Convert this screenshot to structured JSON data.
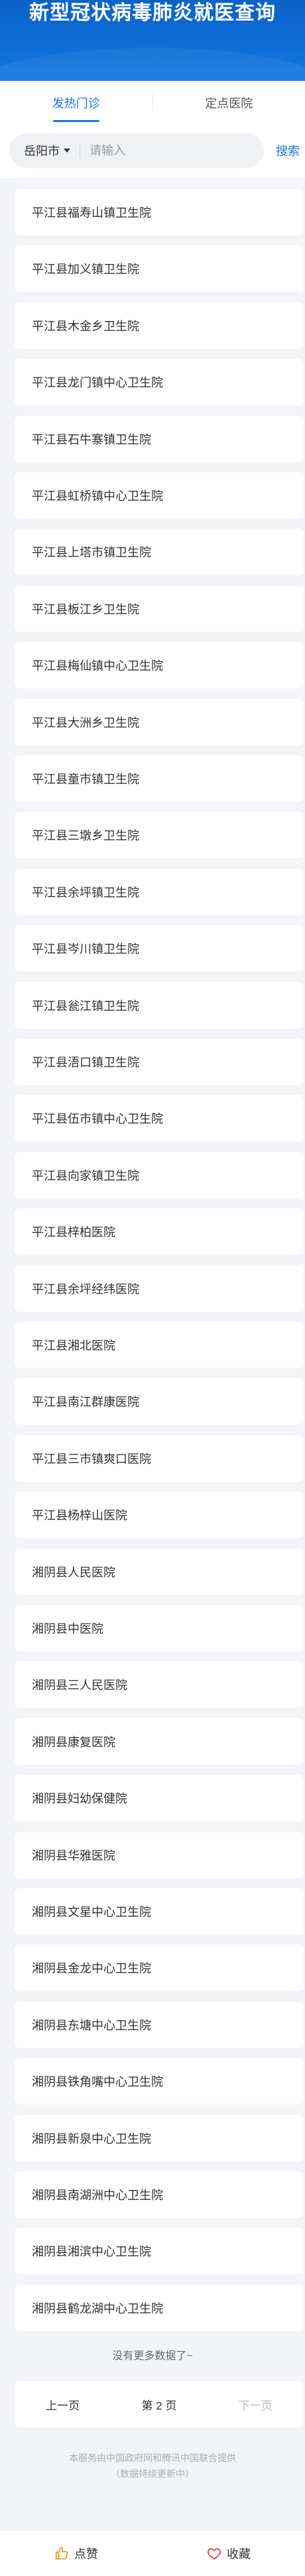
{
  "header": {
    "title": "新型冠状病毒肺炎就医查询"
  },
  "tabs": [
    {
      "label": "发热门诊",
      "active": true
    },
    {
      "label": "定点医院",
      "active": false
    }
  ],
  "search": {
    "city": "岳阳市",
    "placeholder": "请输入",
    "button": "搜索"
  },
  "hospitals": [
    "平江县福寿山镇卫生院",
    "平江县加义镇卫生院",
    "平江县木金乡卫生院",
    "平江县龙门镇中心卫生院",
    "平江县石牛寨镇卫生院",
    "平江县虹桥镇中心卫生院",
    "平江县上塔市镇卫生院",
    "平江县板江乡卫生院",
    "平江县梅仙镇中心卫生院",
    "平江县大洲乡卫生院",
    "平江县童市镇卫生院",
    "平江县三墩乡卫生院",
    "平江县余坪镇卫生院",
    "平江县岑川镇卫生院",
    "平江县瓮江镇卫生院",
    "平江县浯口镇卫生院",
    "平江县伍市镇中心卫生院",
    "平江县向家镇卫生院",
    "平江县梓柏医院",
    "平江县余坪经纬医院",
    "平江县湘北医院",
    "平江县南江群康医院",
    "平江县三市镇爽口医院",
    "平江县杨梓山医院",
    "湘阴县人民医院",
    "湘阴县中医院",
    "湘阴县三人民医院",
    "湘阴县康复医院",
    "湘阴县妇幼保健院",
    "湘阴县华雅医院",
    "湘阴县文星中心卫生院",
    "湘阴县金龙中心卫生院",
    "湘阴县东塘中心卫生院",
    "湘阴县铁角嘴中心卫生院",
    "湘阴县新泉中心卫生院",
    "湘阴县南湖洲中心卫生院",
    "湘阴县湘滨中心卫生院",
    "湘阴县鹤龙湖中心卫生院"
  ],
  "list_end": "没有更多数据了~",
  "pagination": {
    "prev": "上一页",
    "current": "第 2 页",
    "next": "下一页"
  },
  "source": {
    "line1": "本服务由中国政府网和腾讯中国联合提供",
    "line2": "（数据持续更新中）"
  },
  "footer": {
    "like": "点赞",
    "favorite": "收藏"
  },
  "colors": {
    "header": "#0d6fd6",
    "accent": "#1a73e8",
    "background": "#f2f4f7"
  }
}
